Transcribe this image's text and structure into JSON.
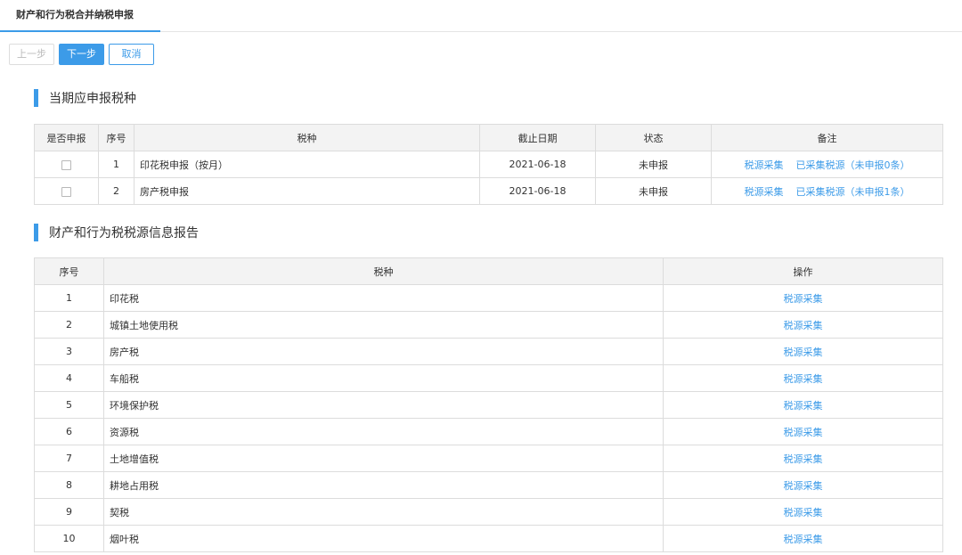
{
  "tab": {
    "title": "财产和行为税合并纳税申报"
  },
  "toolbar": {
    "prev": "上一步",
    "next": "下一步",
    "cancel": "取消"
  },
  "section1": {
    "title": "当期应申报税种",
    "headers": [
      "是否申报",
      "序号",
      "税种",
      "截止日期",
      "状态",
      "备注"
    ],
    "rows": [
      {
        "no": "1",
        "tax": "印花税申报（按月）",
        "deadline": "2021-06-18",
        "status": "未申报",
        "link1": "税源采集",
        "link2": "已采集税源（未申报0条）"
      },
      {
        "no": "2",
        "tax": "房产税申报",
        "deadline": "2021-06-18",
        "status": "未申报",
        "link1": "税源采集",
        "link2": "已采集税源（未申报1条）"
      }
    ]
  },
  "section2": {
    "title": "财产和行为税税源信息报告",
    "headers": [
      "序号",
      "税种",
      "操作"
    ],
    "rows": [
      {
        "no": "1",
        "tax": "印花税",
        "op": "税源采集"
      },
      {
        "no": "2",
        "tax": "城镇土地使用税",
        "op": "税源采集"
      },
      {
        "no": "3",
        "tax": "房产税",
        "op": "税源采集"
      },
      {
        "no": "4",
        "tax": "车船税",
        "op": "税源采集"
      },
      {
        "no": "5",
        "tax": "环境保护税",
        "op": "税源采集"
      },
      {
        "no": "6",
        "tax": "资源税",
        "op": "税源采集"
      },
      {
        "no": "7",
        "tax": "土地增值税",
        "op": "税源采集"
      },
      {
        "no": "8",
        "tax": "耕地占用税",
        "op": "税源采集"
      },
      {
        "no": "9",
        "tax": "契税",
        "op": "税源采集"
      },
      {
        "no": "10",
        "tax": "烟叶税",
        "op": "税源采集"
      }
    ]
  },
  "colors": {
    "accent": "#3c9be8",
    "header_bg": "#f3f3f3",
    "border": "#dcdcdc"
  }
}
